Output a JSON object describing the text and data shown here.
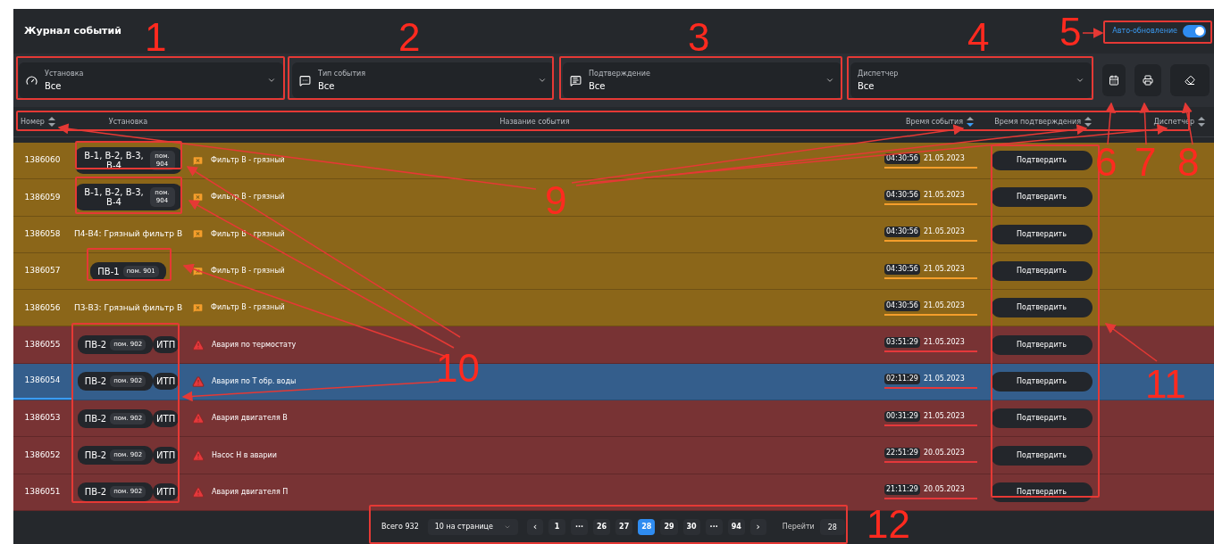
{
  "title": "Журнал событий",
  "auto_refresh": {
    "label": "Авто-обновление",
    "on": true
  },
  "filters": [
    {
      "label": "Установка",
      "value": "Все"
    },
    {
      "label": "Тип события",
      "value": "Все"
    },
    {
      "label": "Подтверждение",
      "value": "Все"
    },
    {
      "label": "Диспетчер",
      "value": "Все"
    }
  ],
  "columns": [
    {
      "label": "Номер",
      "sorted": false
    },
    {
      "label": "Установка"
    },
    {
      "label": "Название события"
    },
    {
      "label": "Время события",
      "sorted": true
    },
    {
      "label": "Время подтверждения",
      "sorted": false
    },
    {
      "label": "Диспетчер",
      "sorted": false
    }
  ],
  "rows": [
    {
      "number": "1386060",
      "kind": "warning",
      "selected": false,
      "unit": {
        "kind": "chip",
        "name": "В-1, В-2, В-3, В-4",
        "room": "пом. 904"
      },
      "event": "Фильтр В - грязный",
      "time": "04:30:56",
      "date": "21.05.2023",
      "action": "Подтвердить"
    },
    {
      "number": "1386059",
      "kind": "warning",
      "selected": false,
      "unit": {
        "kind": "chip",
        "name": "В-1, В-2, В-3, В-4",
        "room": "пом. 904"
      },
      "event": "Фильтр В - грязный",
      "time": "04:30:56",
      "date": "21.05.2023",
      "action": "Подтвердить"
    },
    {
      "number": "1386058",
      "kind": "warning",
      "selected": false,
      "unit": {
        "kind": "text",
        "name": "П4-В4: Грязный фильтр В"
      },
      "event": "Фильтр В - грязный",
      "time": "04:30:56",
      "date": "21.05.2023",
      "action": "Подтвердить"
    },
    {
      "number": "1386057",
      "kind": "warning",
      "selected": false,
      "unit": {
        "kind": "chip",
        "name": "ПВ-1",
        "room": "пом. 901"
      },
      "event": "Фильтр В - грязный",
      "time": "04:30:56",
      "date": "21.05.2023",
      "action": "Подтвердить"
    },
    {
      "number": "1386056",
      "kind": "warning",
      "selected": false,
      "unit": {
        "kind": "text",
        "name": "П3-В3: Грязный фильтр В"
      },
      "event": "Фильтр В - грязный",
      "time": "04:30:56",
      "date": "21.05.2023",
      "action": "Подтвердить"
    },
    {
      "number": "1386055",
      "kind": "alarm",
      "selected": false,
      "unit": {
        "kind": "chip",
        "name": "ПВ-2",
        "room": "пом. 902",
        "extra": "ИТП"
      },
      "event": "Авария по термостату",
      "time": "03:51:29",
      "date": "21.05.2023",
      "action": "Подтвердить"
    },
    {
      "number": "1386054",
      "kind": "alarm",
      "selected": true,
      "unit": {
        "kind": "chip",
        "name": "ПВ-2",
        "room": "пом. 902",
        "extra": "ИТП"
      },
      "event": "Авария по Т обр. воды",
      "time": "02:11:29",
      "date": "21.05.2023",
      "action": "Подтвердить"
    },
    {
      "number": "1386053",
      "kind": "alarm",
      "selected": false,
      "unit": {
        "kind": "chip",
        "name": "ПВ-2",
        "room": "пом. 902",
        "extra": "ИТП"
      },
      "event": "Авария двигателя В",
      "time": "00:31:29",
      "date": "21.05.2023",
      "action": "Подтвердить"
    },
    {
      "number": "1386052",
      "kind": "alarm",
      "selected": false,
      "unit": {
        "kind": "chip",
        "name": "ПВ-2",
        "room": "пом. 902",
        "extra": "ИТП"
      },
      "event": "Насос Н в аварии",
      "time": "22:51:29",
      "date": "20.05.2023",
      "action": "Подтвердить"
    },
    {
      "number": "1386051",
      "kind": "alarm",
      "selected": false,
      "unit": {
        "kind": "chip",
        "name": "ПВ-2",
        "room": "пом. 902",
        "extra": "ИТП"
      },
      "event": "Авария двигателя П",
      "time": "21:11:29",
      "date": "20.05.2023",
      "action": "Подтвердить"
    }
  ],
  "pagination": {
    "total": "Всего 932",
    "per_page": "10 на странице",
    "prev": "‹",
    "next": "›",
    "pages": [
      {
        "label": "1",
        "selected": false
      },
      {
        "label": "···",
        "selected": false
      },
      {
        "label": "26",
        "selected": false
      },
      {
        "label": "27",
        "selected": false
      },
      {
        "label": "28",
        "selected": true
      },
      {
        "label": "29",
        "selected": false
      },
      {
        "label": "30",
        "selected": false
      },
      {
        "label": "···",
        "selected": false
      },
      {
        "label": "94",
        "selected": false
      }
    ],
    "goto_label": "Перейти",
    "goto_value": "28"
  },
  "annotations": [
    {
      "label": "1"
    },
    {
      "label": "2"
    },
    {
      "label": "3"
    },
    {
      "label": "4"
    },
    {
      "label": "5"
    },
    {
      "label": "6"
    },
    {
      "label": "7"
    },
    {
      "label": "8"
    },
    {
      "label": "9"
    },
    {
      "label": "10"
    },
    {
      "label": "11"
    },
    {
      "label": "12"
    }
  ]
}
